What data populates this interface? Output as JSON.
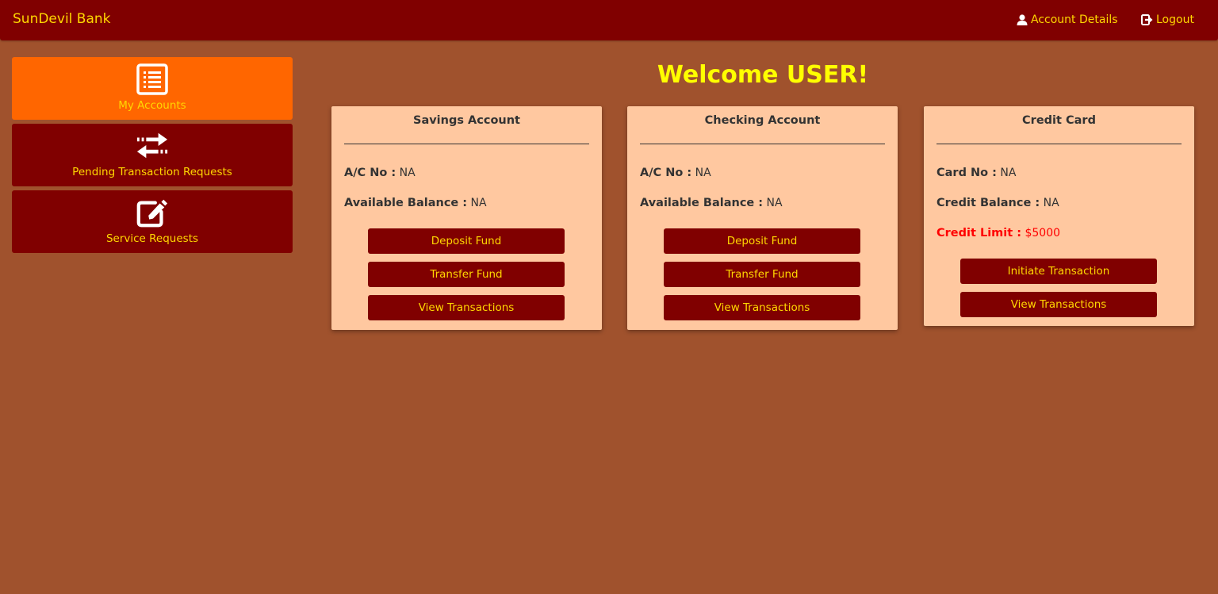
{
  "navbar": {
    "brand": "SunDevil Bank",
    "account_details": "Account Details",
    "logout": "Logout"
  },
  "sidebar": {
    "items": [
      {
        "label": "My Accounts",
        "icon": "list-icon",
        "active": true
      },
      {
        "label": "Pending Transaction Requests",
        "icon": "transfer-arrows-icon",
        "active": false
      },
      {
        "label": "Service Requests",
        "icon": "edit-icon",
        "active": false
      }
    ]
  },
  "main": {
    "welcome": "Welcome USER!",
    "cards": [
      {
        "title": "Savings Account",
        "rows": [
          {
            "label": "A/C No :",
            "value": "NA"
          },
          {
            "label": "Available Balance :",
            "value": "NA"
          }
        ],
        "buttons": [
          "Deposit Fund",
          "Transfer Fund",
          "View Transactions"
        ]
      },
      {
        "title": "Checking Account",
        "rows": [
          {
            "label": "A/C No :",
            "value": "NA"
          },
          {
            "label": "Available Balance :",
            "value": "NA"
          }
        ],
        "buttons": [
          "Deposit Fund",
          "Transfer Fund",
          "View Transactions"
        ]
      },
      {
        "title": "Credit Card",
        "rows": [
          {
            "label": "Card No :",
            "value": "NA"
          },
          {
            "label": "Credit Balance :",
            "value": "NA"
          },
          {
            "label": "Credit Limit :",
            "value": "$5000"
          }
        ],
        "buttons": [
          "Initiate Transaction",
          "View Transactions"
        ]
      }
    ]
  },
  "colors": {
    "page_bg": "#a0522d",
    "navbar_bg": "#800000",
    "accent_text": "#ffd700",
    "active_sidebar": "#ff6600",
    "card_bg": "#ffc8a0",
    "welcome_text": "#ffff00",
    "credit_limit_text": "#ff0000"
  }
}
